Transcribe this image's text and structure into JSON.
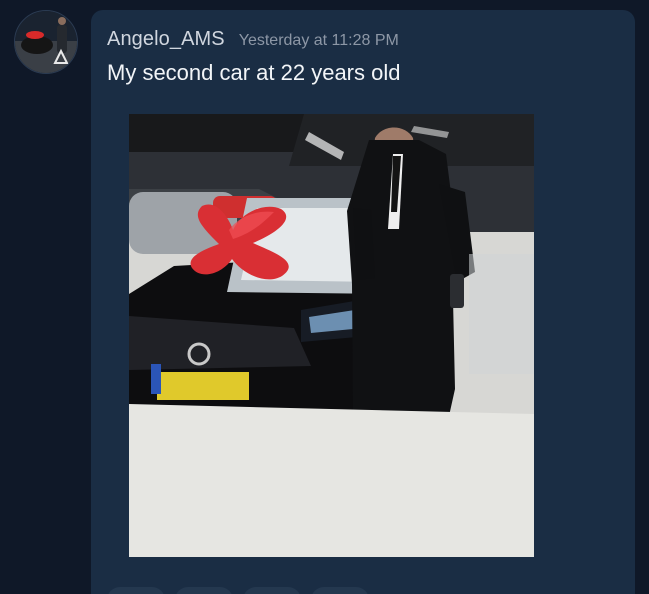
{
  "message": {
    "author": "Angelo_AMS",
    "timestamp": "Yesterday at 11:28 PM",
    "text": "My second car at 22 years old",
    "avatar_icon": "user-avatar",
    "image_alt": "photo-of-car-with-red-bow"
  },
  "colors": {
    "background": "#0f1828",
    "bubble": "#1a2d44",
    "text": "#f2f5f8",
    "muted": "#8d97a6",
    "bow": "#d82a2a"
  }
}
